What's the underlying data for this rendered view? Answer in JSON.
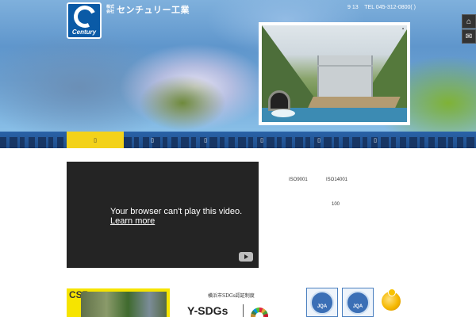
{
  "header": {
    "logo_word": "Century",
    "company_prefix": "株式会社",
    "company_name": "センチュリー工業",
    "info_prefix": "9  13",
    "tel": "TEL 045-312-0800(  )"
  },
  "side_buttons": [
    {
      "icon": "home-icon",
      "glyph": "⌂"
    },
    {
      "icon": "mail-icon",
      "glyph": "✉"
    }
  ],
  "hero_photo": {
    "subject": "dam-construction-photo",
    "close_glyph": "▪"
  },
  "nav": {
    "items": [
      {
        "label": "▯",
        "active": true
      },
      {
        "label": "▯",
        "active": false
      },
      {
        "label": "▯",
        "active": false
      },
      {
        "label": "▯",
        "active": false
      },
      {
        "label": "▯",
        "active": false
      },
      {
        "label": "▯",
        "active": false
      }
    ]
  },
  "video": {
    "message": "Your browser can't play this video.",
    "link": "Learn more"
  },
  "certifications": {
    "iso1": "ISO9001",
    "iso2": "ISO14001",
    "count": "100"
  },
  "banners": {
    "csr_text": "CSR",
    "sdgs_caption": "横浜市SDGs認証制度",
    "ysdgs": "Y-SDGs",
    "jqa_label": "JQA"
  },
  "colors": {
    "nav_active": "#f3d21a",
    "brand_blue": "#0a5aa6"
  }
}
